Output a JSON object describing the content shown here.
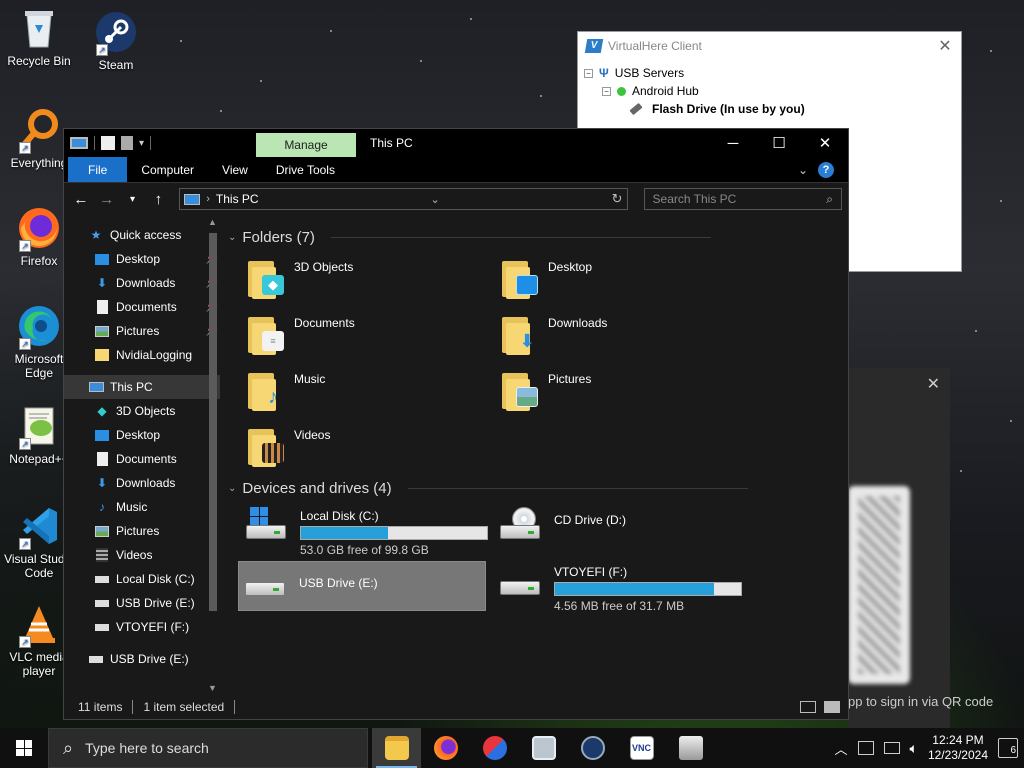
{
  "desktop": {
    "icons": [
      {
        "label": "Recycle Bin",
        "icon": "recycle-bin-icon"
      },
      {
        "label": "Steam",
        "icon": "steam-icon"
      },
      {
        "label": "Everything",
        "icon": "everything-icon"
      },
      {
        "label": "Firefox",
        "icon": "firefox-icon"
      },
      {
        "label": "Microsoft Edge",
        "icon": "edge-icon"
      },
      {
        "label": "Notepad++",
        "icon": "notepadpp-icon"
      },
      {
        "label": "Visual Studio Code",
        "icon": "vscode-icon"
      },
      {
        "label": "VLC media player",
        "icon": "vlc-icon"
      }
    ]
  },
  "virtualhere": {
    "title": "VirtualHere Client",
    "tree": {
      "root": "USB Servers",
      "hub": "Android Hub",
      "device": "Flash Drive (In use by you)"
    }
  },
  "qr_panel": {
    "text": "pp to sign in via QR code"
  },
  "explorer": {
    "title": "This PC",
    "manage_tab": "Manage",
    "ribbon": {
      "file": "File",
      "tabs": [
        "Computer",
        "View",
        "Drive Tools"
      ],
      "help": "?"
    },
    "address": {
      "path": "This PC",
      "search_placeholder": "Search This PC"
    },
    "nav": {
      "quick_access": "Quick access",
      "quick_items": [
        {
          "label": "Desktop",
          "pinned": true
        },
        {
          "label": "Downloads",
          "pinned": true
        },
        {
          "label": "Documents",
          "pinned": true
        },
        {
          "label": "Pictures",
          "pinned": true
        },
        {
          "label": "NvidiaLogging",
          "pinned": false
        }
      ],
      "this_pc": "This PC",
      "pc_items": [
        "3D Objects",
        "Desktop",
        "Documents",
        "Downloads",
        "Music",
        "Pictures",
        "Videos",
        "Local Disk (C:)",
        "USB Drive (E:)",
        "VTOYEFI (F:)"
      ],
      "usb_root": "USB Drive (E:)"
    },
    "folders_header": "Folders (7)",
    "folders": [
      "3D Objects",
      "Desktop",
      "Documents",
      "Downloads",
      "Music",
      "Pictures",
      "Videos"
    ],
    "drives_header": "Devices and drives (4)",
    "drives": [
      {
        "name": "Local Disk (C:)",
        "free": "53.0 GB free of 99.8 GB",
        "used_fraction": 0.469
      },
      {
        "name": "CD Drive (D:)",
        "free": "",
        "used_fraction": null
      },
      {
        "name": "USB Drive (E:)",
        "free": "",
        "used_fraction": null,
        "selected": true
      },
      {
        "name": "VTOYEFI (F:)",
        "free": "4.56 MB free of 31.7 MB",
        "used_fraction": 0.856
      }
    ],
    "status": {
      "items": "11 items",
      "selected": "1 item selected"
    }
  },
  "taskbar": {
    "search_placeholder": "Type here to search",
    "apps": [
      "file-explorer-icon",
      "firefox-icon",
      "app-red-blue-icon",
      "app-window-icon",
      "steam-icon",
      "vnc-icon",
      "virtualhere-icon"
    ],
    "vnc_label": "VNC",
    "time": "12:24 PM",
    "date": "12/23/2024",
    "notifications": "6"
  },
  "colors": {
    "accent": "#1a6fc9",
    "manage_tab": "#b9e6b2",
    "drive_bar": "#26a0da",
    "folder": "#f6d774"
  }
}
